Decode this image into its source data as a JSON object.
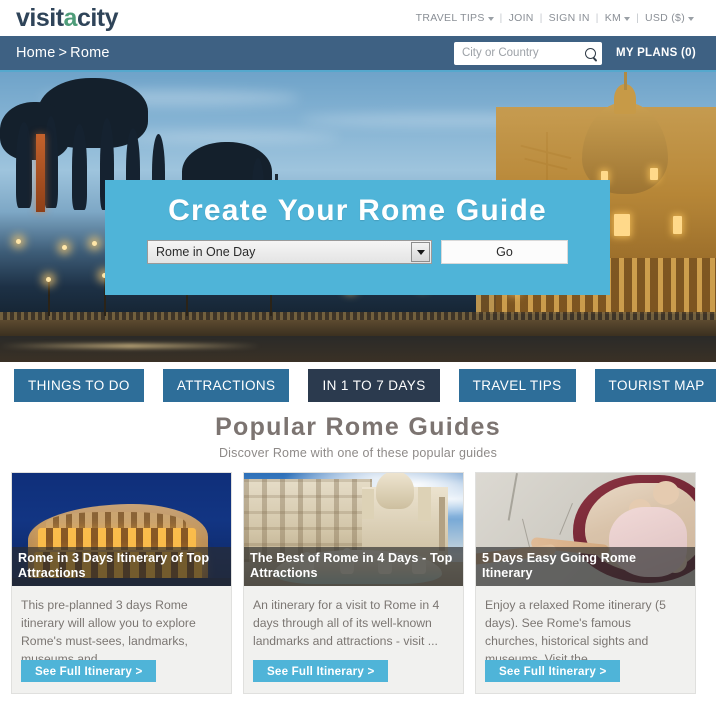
{
  "brand": {
    "logo_part1": "visit",
    "logo_accent": "a",
    "logo_part2": "city"
  },
  "topnav": {
    "items": [
      {
        "label": "TRAVEL TIPS",
        "caret": true
      },
      {
        "label": "JOIN",
        "caret": false
      },
      {
        "label": "SIGN IN",
        "caret": false
      },
      {
        "label": "KM",
        "caret": true
      },
      {
        "label": "USD ($)",
        "caret": true
      }
    ],
    "separator": "|"
  },
  "breadcrumb": {
    "home": "Home",
    "separator": ">",
    "current": "Rome"
  },
  "search": {
    "placeholder": "City or Country",
    "value": "",
    "icon": "search-icon"
  },
  "my_plans": {
    "label": "MY PLANS (0)"
  },
  "hero": {
    "title": "Create Your Rome Guide",
    "select_value": "Rome in One Day",
    "go_label": "Go",
    "panel_color": "#4fb4d8"
  },
  "categories": [
    {
      "label": "THINGS TO DO",
      "active": false
    },
    {
      "label": "ATTRACTIONS",
      "active": false
    },
    {
      "label": "IN 1 TO 7 DAYS",
      "active": true
    },
    {
      "label": "TRAVEL TIPS",
      "active": false
    },
    {
      "label": "TOURIST MAP",
      "active": false
    }
  ],
  "section": {
    "title": "Popular Rome Guides",
    "subtitle": "Discover Rome with one of these popular guides"
  },
  "cards": [
    {
      "title": "Rome in 3 Days Itinerary of Top Attractions",
      "description": "This pre-planned 3 days Rome itinerary will allow you to explore Rome's must-sees, landmarks, museums and ...",
      "button": "See Full Itinerary >",
      "image_alt": "colosseum-at-night"
    },
    {
      "title": "The Best of Rome in 4 Days - Top Attractions",
      "description": "An itinerary for a visit to Rome in 4 days through all of its well-known landmarks and attractions - visit ...",
      "button": "See Full Itinerary >",
      "image_alt": "piazza-navona-fountain"
    },
    {
      "title": "5 Days Easy Going Rome Itinerary",
      "description": "Enjoy a relaxed Rome itinerary (5 days). See Rome's famous churches, historical sights and museums. Visit the ...",
      "button": "See Full Itinerary >",
      "image_alt": "creation-of-adam-sistine-chapel"
    }
  ],
  "colors": {
    "brand_dark": "#2f4459",
    "brand_accent": "#4f9d7a",
    "nav_bar": "#3e6183",
    "nav_underline": "#55a8cd",
    "button_blue": "#2e6e99",
    "button_active": "#2b3a4e",
    "cyan": "#4fb4d8"
  }
}
